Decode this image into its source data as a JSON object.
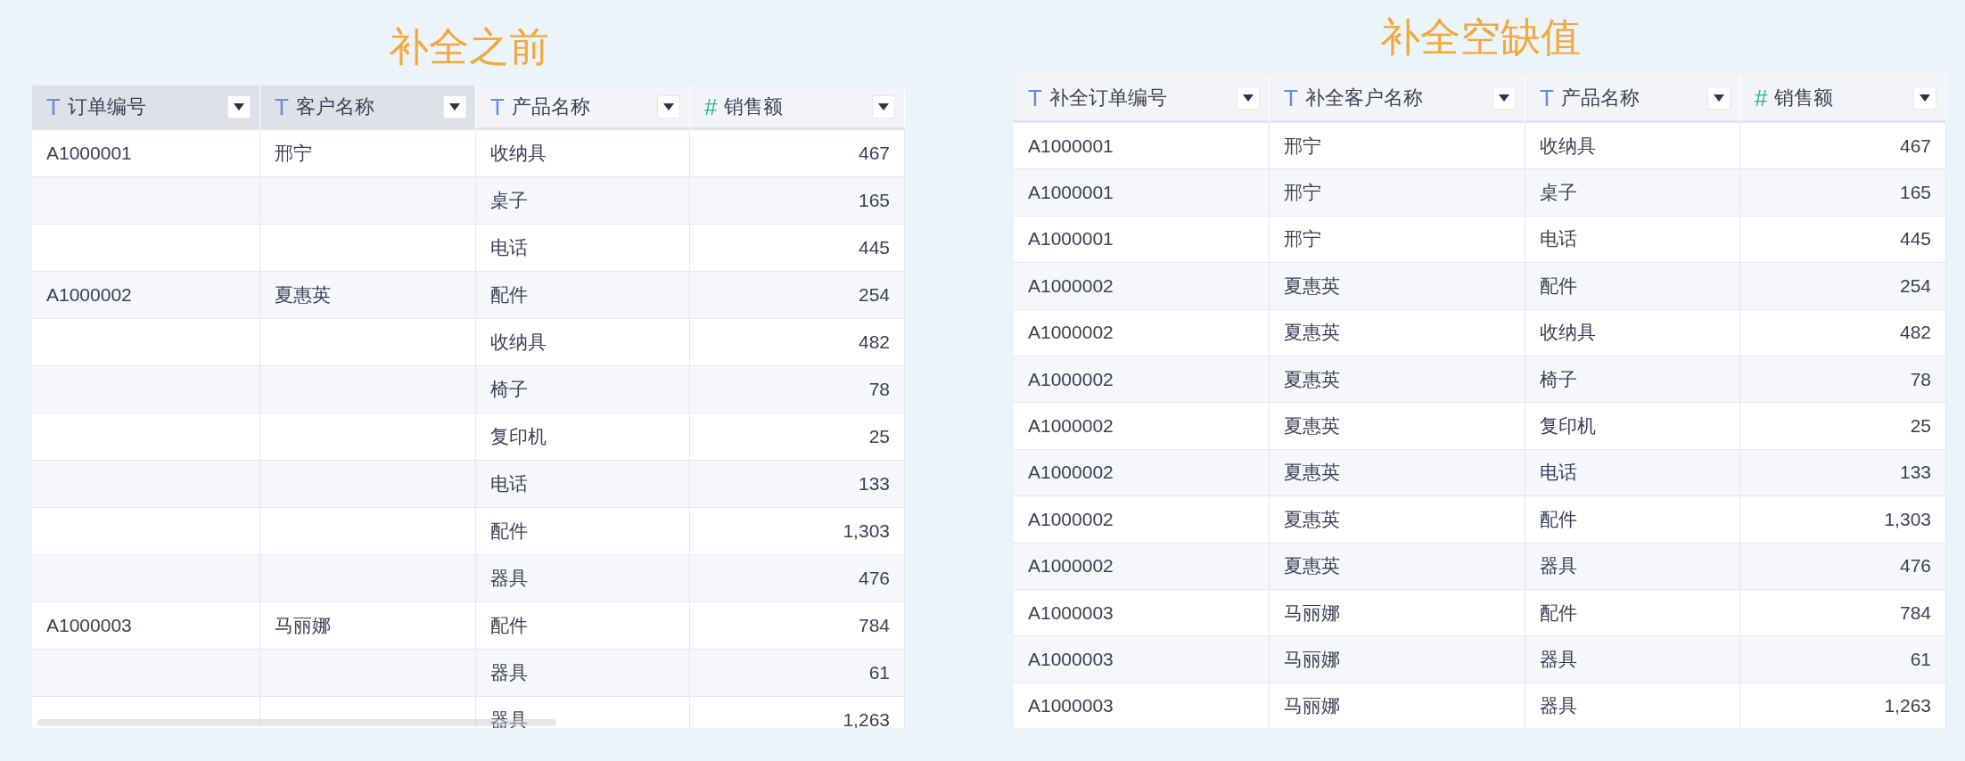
{
  "tables": [
    {
      "title": "补全之前",
      "scrollbar": true,
      "columns": [
        {
          "icon": "T",
          "kind": "text",
          "label": "订单编号",
          "highlighted": true
        },
        {
          "icon": "T",
          "kind": "text",
          "label": "客户名称",
          "highlighted": true
        },
        {
          "icon": "T",
          "kind": "text",
          "label": "产品名称",
          "highlighted": false
        },
        {
          "icon": "#",
          "kind": "number",
          "label": "销售额",
          "highlighted": false
        }
      ],
      "rows": [
        [
          "A1000001",
          "邢宁",
          "收纳具",
          "467"
        ],
        [
          "",
          "",
          "桌子",
          "165"
        ],
        [
          "",
          "",
          "电话",
          "445"
        ],
        [
          "A1000002",
          "夏惠英",
          "配件",
          "254"
        ],
        [
          "",
          "",
          "收纳具",
          "482"
        ],
        [
          "",
          "",
          "椅子",
          "78"
        ],
        [
          "",
          "",
          "复印机",
          "25"
        ],
        [
          "",
          "",
          "电话",
          "133"
        ],
        [
          "",
          "",
          "配件",
          "1,303"
        ],
        [
          "",
          "",
          "器具",
          "476"
        ],
        [
          "A1000003",
          "马丽娜",
          "配件",
          "784"
        ],
        [
          "",
          "",
          "器具",
          "61"
        ],
        [
          "",
          "",
          "器具",
          "1,263"
        ]
      ]
    },
    {
      "title": "补全空缺值",
      "scrollbar": false,
      "columns": [
        {
          "icon": "T",
          "kind": "text",
          "label": "补全订单编号",
          "highlighted": false
        },
        {
          "icon": "T",
          "kind": "text",
          "label": "补全客户名称",
          "highlighted": false
        },
        {
          "icon": "T",
          "kind": "text",
          "label": "产品名称",
          "highlighted": false
        },
        {
          "icon": "#",
          "kind": "number",
          "label": "销售额",
          "highlighted": false
        }
      ],
      "rows": [
        [
          "A1000001",
          "邢宁",
          "收纳具",
          "467"
        ],
        [
          "A1000001",
          "邢宁",
          "桌子",
          "165"
        ],
        [
          "A1000001",
          "邢宁",
          "电话",
          "445"
        ],
        [
          "A1000002",
          "夏惠英",
          "配件",
          "254"
        ],
        [
          "A1000002",
          "夏惠英",
          "收纳具",
          "482"
        ],
        [
          "A1000002",
          "夏惠英",
          "椅子",
          "78"
        ],
        [
          "A1000002",
          "夏惠英",
          "复印机",
          "25"
        ],
        [
          "A1000002",
          "夏惠英",
          "电话",
          "133"
        ],
        [
          "A1000002",
          "夏惠英",
          "配件",
          "1,303"
        ],
        [
          "A1000002",
          "夏惠英",
          "器具",
          "476"
        ],
        [
          "A1000003",
          "马丽娜",
          "配件",
          "784"
        ],
        [
          "A1000003",
          "马丽娜",
          "器具",
          "61"
        ],
        [
          "A1000003",
          "马丽娜",
          "器具",
          "1,263"
        ]
      ]
    }
  ]
}
